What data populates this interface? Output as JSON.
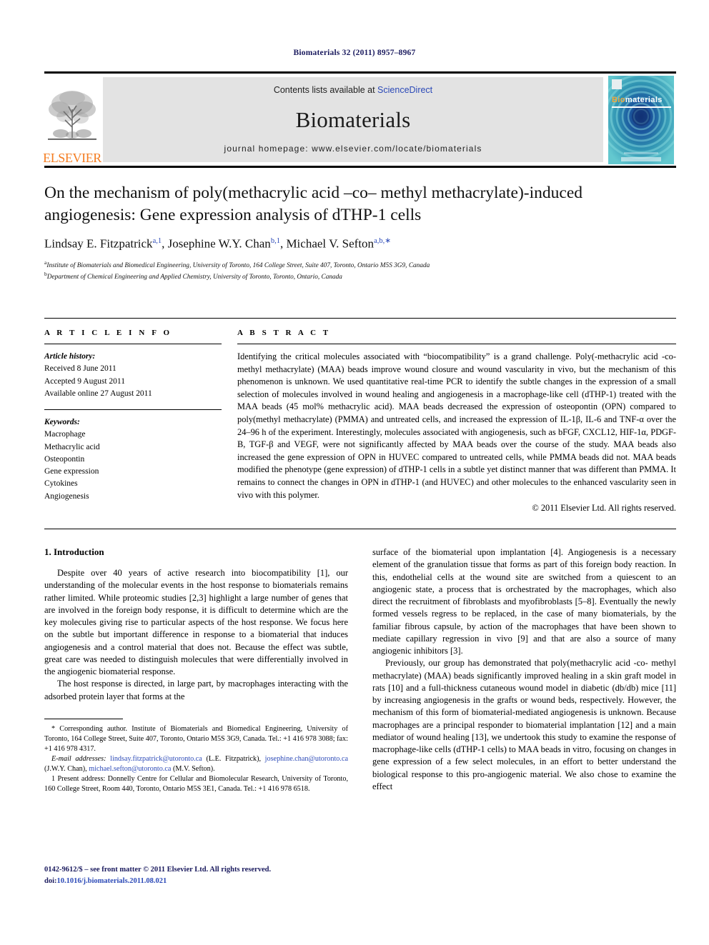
{
  "running_head": "Biomaterials 32 (2011) 8957–8967",
  "masthead": {
    "publisher_name": "ELSEVIER",
    "contents_prefix": "Contents lists available at ",
    "contents_link": "ScienceDirect",
    "journal_name": "Biomaterials",
    "homepage": "journal homepage: www.elsevier.com/locate/biomaterials",
    "cover": {
      "title_part1": "Bio",
      "title_part2": "materials"
    },
    "colors": {
      "elsevier_orange": "#f47c20",
      "link_blue": "#2b49b7",
      "band_gray": "#e3e3e3",
      "cover_teal": "#2fa8b8"
    }
  },
  "article": {
    "title": "On the mechanism of poly(methacrylic acid –co– methyl methacrylate)-induced angiogenesis: Gene expression analysis of dTHP-1 cells",
    "authors": [
      {
        "name": "Lindsay E. Fitzpatrick",
        "marks": "a,1",
        "sep": ", "
      },
      {
        "name": "Josephine W.Y. Chan",
        "marks": "b,1",
        "sep": ", "
      },
      {
        "name": "Michael V. Sefton",
        "marks": "a,b,∗",
        "sep": ""
      }
    ],
    "affiliations": [
      {
        "mark": "a",
        "text": "Institute of Biomaterials and Biomedical Engineering, University of Toronto, 164 College Street, Suite 407, Toronto, Ontario M5S 3G9, Canada"
      },
      {
        "mark": "b",
        "text": "Department of Chemical Engineering and Applied Chemistry, University of Toronto, Toronto, Ontario, Canada"
      }
    ]
  },
  "article_info": {
    "heading": "A R T I C L E  I N F O",
    "history_label": "Article history:",
    "history": [
      "Received 8 June 2011",
      "Accepted 9 August 2011",
      "Available online 27 August 2011"
    ],
    "keywords_label": "Keywords:",
    "keywords": [
      "Macrophage",
      "Methacrylic acid",
      "Osteopontin",
      "Gene expression",
      "Cytokines",
      "Angiogenesis"
    ]
  },
  "abstract": {
    "heading": "A B S T R A C T",
    "text": "Identifying the critical molecules associated with “biocompatibility” is a grand challenge. Poly(-methacrylic acid -co- methyl methacrylate) (MAA) beads improve wound closure and wound vascularity in vivo, but the mechanism of this phenomenon is unknown. We used quantitative real-time PCR to identify the subtle changes in the expression of a small selection of molecules involved in wound healing and angiogenesis in a macrophage-like cell (dTHP-1) treated with the MAA beads (45 mol% methacrylic acid). MAA beads decreased the expression of osteopontin (OPN) compared to poly(methyl methacrylate) (PMMA) and untreated cells, and increased the expression of IL-1β, IL-6 and TNF-α over the 24–96 h of the experiment. Interestingly, molecules associated with angiogenesis, such as bFGF, CXCL12, HIF-1α, PDGF-B, TGF-β and VEGF, were not significantly affected by MAA beads over the course of the study. MAA beads also increased the gene expression of OPN in HUVEC compared to untreated cells, while PMMA beads did not. MAA beads modified the phenotype (gene expression) of dTHP-1 cells in a subtle yet distinct manner that was different than PMMA. It remains to connect the changes in OPN in dTHP-1 (and HUVEC) and other molecules to the enhanced vascularity seen in vivo with this polymer.",
    "copyright": "© 2011 Elsevier Ltd. All rights reserved."
  },
  "introduction": {
    "section_number_title": "1.  Introduction",
    "left_paragraphs": [
      "Despite over 40 years of active research into biocompatibility [1], our understanding of the molecular events in the host response to biomaterials remains rather limited. While proteomic studies [2,3] highlight a large number of genes that are involved in the foreign body response, it is difficult to determine which are the key molecules giving rise to particular aspects of the host response. We focus here on the subtle but important difference in response to a biomaterial that induces angiogenesis and a control material that does not. Because the effect was subtle, great care was needed to distinguish molecules that were differentially involved in the angiogenic biomaterial response.",
      "The host response is directed, in large part, by macrophages interacting with the adsorbed protein layer that forms at the"
    ],
    "right_paragraphs": [
      "surface of the biomaterial upon implantation [4]. Angiogenesis is a necessary element of the granulation tissue that forms as part of this foreign body reaction. In this, endothelial cells at the wound site are switched from a quiescent to an angiogenic state, a process that is orchestrated by the macrophages, which also direct the recruitment of fibroblasts and myofibroblasts [5–8]. Eventually the newly formed vessels regress to be replaced, in the case of many biomaterials, by the familiar fibrous capsule, by action of the macrophages that have been shown to mediate capillary regression in vivo [9] and that are also a source of many angiogenic inhibitors [3].",
      "Previously, our group has demonstrated that poly(methacrylic acid -co- methyl methacrylate) (MAA) beads significantly improved healing in a skin graft model in rats [10] and a full-thickness cutaneous wound model in diabetic (db/db) mice [11] by increasing angiogenesis in the grafts or wound beds, respectively. However, the mechanism of this form of biomaterial-mediated angiogenesis is unknown. Because macrophages are a principal responder to biomaterial implantation [12] and a main mediator of wound healing [13], we undertook this study to examine the response of macrophage-like cells (dTHP-1 cells) to MAA beads in vitro, focusing on changes in gene expression of a few select molecules, in an effort to better understand the biological response to this pro-angiogenic material. We also chose to examine the effect"
    ]
  },
  "footnotes": {
    "corresponding": "* Corresponding author. Institute of Biomaterials and Biomedical Engineering, University of Toronto, 164 College Street, Suite 407, Toronto, Ontario M5S 3G9, Canada. Tel.: +1 416 978 3088; fax: +1 416 978 4317.",
    "email_label": "E-mail addresses:",
    "emails": [
      {
        "address": "lindsay.fitzpatrick@utoronto.ca",
        "owner": "(L.E. Fitzpatrick)"
      },
      {
        "address": "josephine.chan@utoronto.ca",
        "owner": "(J.W.Y. Chan)"
      },
      {
        "address": "michael.sefton@utoronto.ca",
        "owner": "(M.V. Sefton)"
      }
    ],
    "present_address": "1 Present address: Donnelly Centre for Cellular and Biomolecular Research, University of Toronto, 160 College Street, Room 440, Toronto, Ontario M5S 3E1, Canada. Tel.: +1 416 978 6518."
  },
  "page_footer": {
    "issn_line": "0142-9612/$ – see front matter © 2011 Elsevier Ltd. All rights reserved.",
    "doi_prefix": "doi:",
    "doi": "10.1016/j.biomaterials.2011.08.021"
  }
}
